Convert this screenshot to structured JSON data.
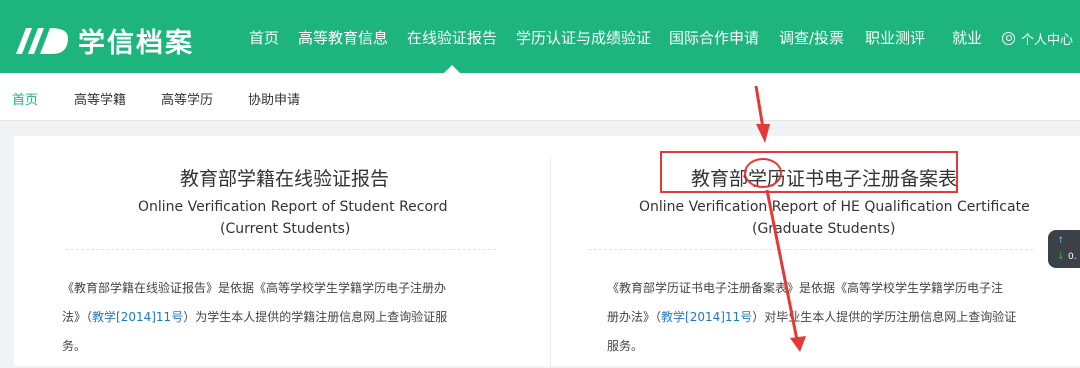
{
  "header": {
    "logo_text": "学信档案",
    "nav": [
      {
        "label": "首页"
      },
      {
        "label": "高等教育信息"
      },
      {
        "label": "在线验证报告"
      },
      {
        "label": "学历认证与成绩验证"
      },
      {
        "label": "国际合作申请"
      },
      {
        "label": "调查/投票"
      },
      {
        "label": "职业测评"
      },
      {
        "label": "就业"
      }
    ],
    "active_nav_index": 2,
    "user_label": "个人中心"
  },
  "subnav": {
    "items": [
      {
        "label": "首页"
      },
      {
        "label": "高等学籍"
      },
      {
        "label": "高等学历"
      },
      {
        "label": "协助申请"
      }
    ],
    "active_index": 0
  },
  "left_card": {
    "title": "教育部学籍在线验证报告",
    "subtitle_en_1": "Online Verification Report of Student Record",
    "subtitle_en_2": "(Current Students)",
    "desc_line_1": "《教育部学籍在线验证报告》是依据《高等学校学生学籍学历电子注册办",
    "desc_line_2_a": "法》（",
    "desc_line_2_link": "教学[2014]11号",
    "desc_line_2_b": "）为学生本人提供的学籍注册信息网上查询验证服",
    "desc_line_3": "务。"
  },
  "right_card": {
    "title": "教育部学历证书电子注册备案表",
    "subtitle_en_1": "Online Verification Report of HE Qualification Certificate",
    "subtitle_en_2": "(Graduate Students)",
    "desc_line_1": "《教育部学历证书电子注册备案表》是依据《高等学校学生学籍学历电子注",
    "desc_line_2_a": "册办法》（",
    "desc_line_2_link": "教学[2014]11号",
    "desc_line_2_b": "）对毕业生本人提供的学历注册信息网上查询验证",
    "desc_line_3": "服务。"
  },
  "float_widget": {
    "up_icon": "↑",
    "down_icon": "↓",
    "value": "0."
  },
  "colors": {
    "brand": "#1db47d",
    "link": "#1f7ac6",
    "annotation": "#e53935"
  }
}
